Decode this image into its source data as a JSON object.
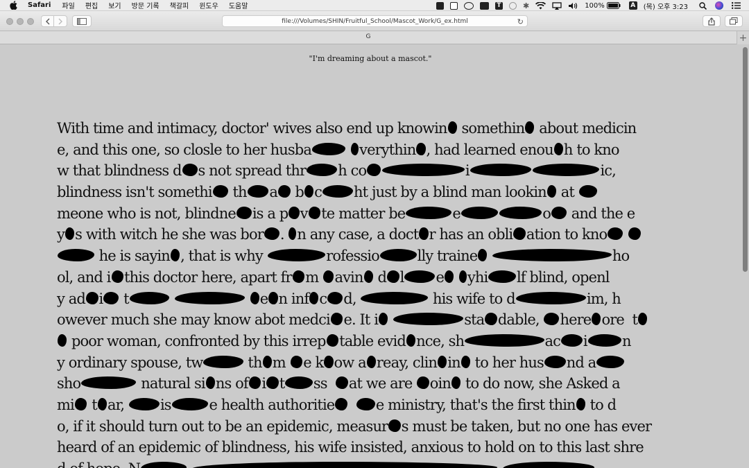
{
  "menubar": {
    "app_name": "Safari",
    "menus": [
      "파일",
      "편집",
      "보기",
      "방문 기록",
      "책갈피",
      "윈도우",
      "도움말"
    ],
    "battery": "100%",
    "input_source": "A",
    "clock": "(목) 오후 3:23"
  },
  "toolbar": {
    "address": "file:///Volumes/SHIN/Fruitful_School/Mascot_Work/G_ex.html"
  },
  "tab": {
    "title": "G"
  },
  "page": {
    "quote": "\"I'm dreaming about a mascot.\"",
    "lines": [
      "With time and intimacy, doctor' wives also end up knowin{6} somethin{6} about medicin",
      "e, and this one, so closle to her husba{22} {5}verythin{6}, had learned enou{6}h to kno",
      "w that blindness d{10}s not spread thr{20}h co{9}{54}i{40}{44}ic,",
      "blindness isn't somethi{10} th{14}a{8} b{6}c{20}ht just by a blind man lookin{6} at {12}",
      "meone who is not, blindne{10}is a p{7}v{8}te matter be{30}e{24}{28}o{10} and the e",
      "y{6}s with witch he she was bor{10}. {5}n any case, a doct{6}r has an obli{8}ation to kno{10} {8}",
      "{24} he is sayin{6}, that is why {38}rofessio{24}lly traine{6} {78}ho",
      "ol, and i{8}this doctor here, apart fr{8}m {7}avin{6} d{8}l{20}e{6} {5}yhi{18}lf blind, openl",
      "y ad{8}i{10} t{26} {46} {6}e{6}n inf{6}c{10}d, {44} his wife to d{46}im, h",
      "owever much she may know abot medci{8}e. It i{6} {46}sta{8}dable, {10}here{6}ore  t{6}",
      "{6} poor woman, confronted by this irrep{8}table evid{6}nce, sh{52}ac{14}i{22}n",
      "y ordinary spouse, tw{26} th{6}m {8}e k{6}ow a{6}reay, clin{6}in{6} to her hus{14}nd a{18}",
      "sho{36} natural si{6}ns of{8}i{8}t{18}ss  {8}at we are {8}oin{6} to do now, she Asked a",
      "mi{8} t{6}ar, {20}is{24}e health authoritie{8}  {12}e ministry, that's the first thin{6} to d",
      "o, if it should turn out to be an epidemic, measur{8}s must be taken, but no one has ever",
      "heard of an epidemic of blindness, his wife insisted, anxious to hold on to this last shre",
      "d of hope. N{30} {200} {60}"
    ]
  }
}
